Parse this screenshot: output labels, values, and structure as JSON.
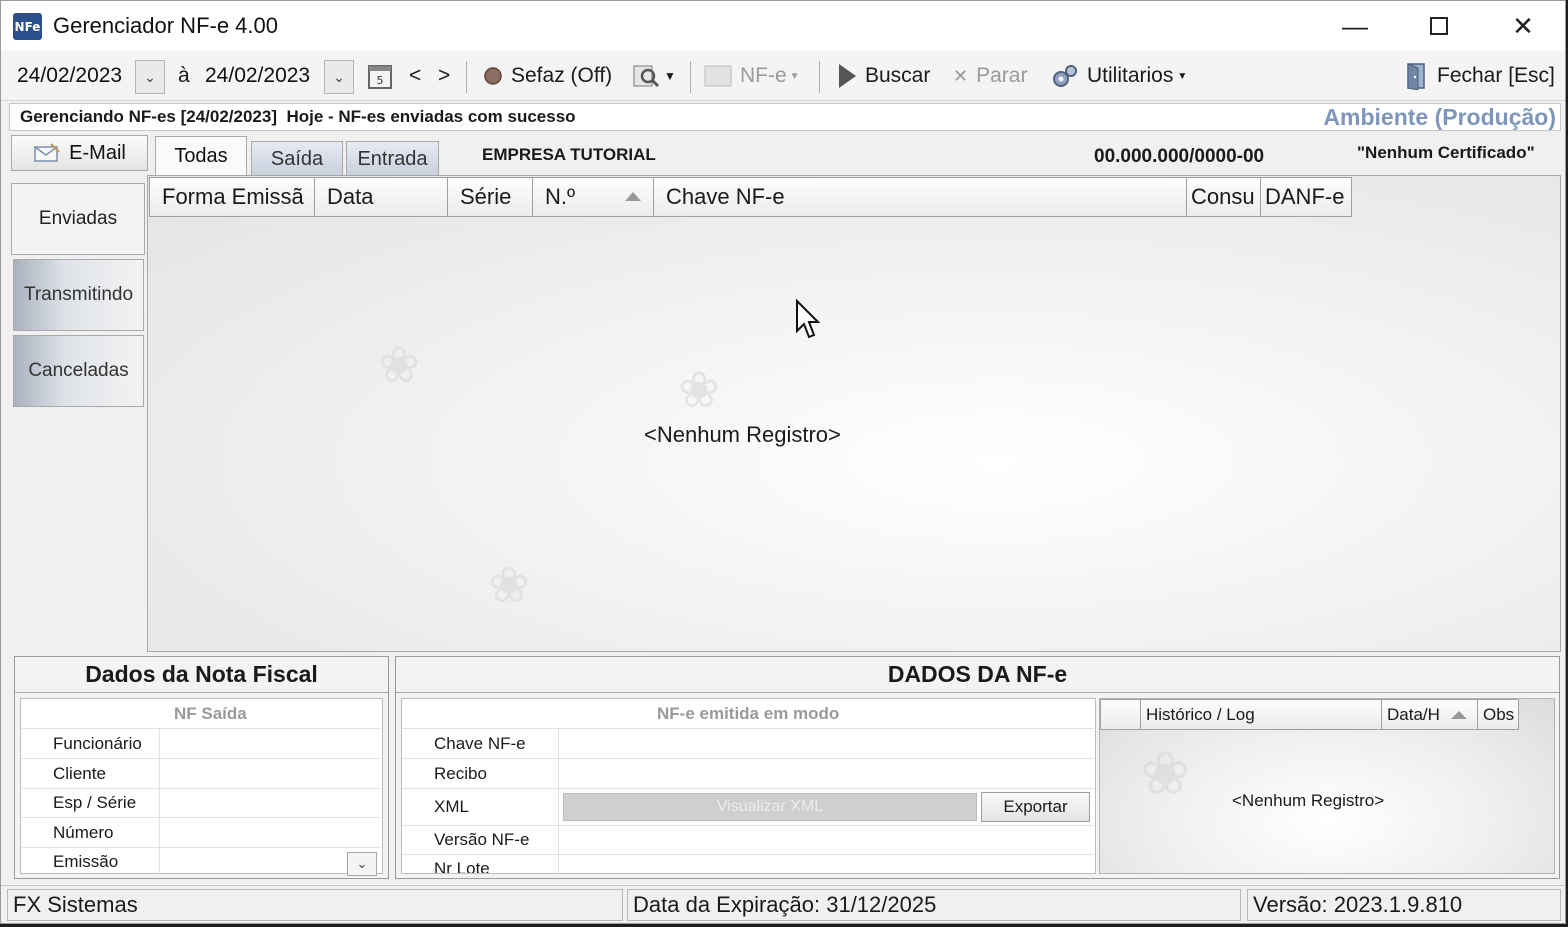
{
  "window": {
    "app_icon_text": "NFe",
    "title": "Gerenciador NF-e 4.00",
    "minimize": "—",
    "close": "✕"
  },
  "toolbar": {
    "date_from": "24/02/2023",
    "date_sep": "à",
    "date_to": "24/02/2023",
    "prev": "<",
    "next": ">",
    "sefaz": "Sefaz (Off)",
    "nfe": "NF-e",
    "buscar": "Buscar",
    "parar": "Parar",
    "utilitarios": "Utilitarios",
    "fechar": "Fechar [Esc]"
  },
  "header": {
    "status": "Gerenciando NF-es [24/02/2023]  Hoje - NF-es enviadas com sucesso",
    "ambiente": "Ambiente (Produção)"
  },
  "tabs": {
    "email": "E-Mail",
    "todas": "Todas",
    "saida": "Saída",
    "entrada": "Entrada"
  },
  "company": {
    "name": "EMPRESA TUTORIAL",
    "cnpj": "00.000.000/0000-00",
    "certificado": "\"Nenhum Certificado\""
  },
  "sidebar": {
    "items": [
      {
        "label": "Enviadas"
      },
      {
        "label": "Transmitindo"
      },
      {
        "label": "Canceladas"
      }
    ]
  },
  "grid": {
    "columns": [
      "Forma Emissã",
      "Data",
      "Série",
      "N.º",
      "Chave NF-e",
      "Consu",
      "DANF-e"
    ],
    "empty": "<Nenhum Registro>"
  },
  "nota_fiscal": {
    "title": "Dados da Nota Fiscal",
    "subtitle": "NF Saída",
    "fields": [
      "Funcionário",
      "Cliente",
      "Esp / Série",
      "Número",
      "Emissão"
    ]
  },
  "nfe_panel": {
    "title": "DADOS DA NF-e",
    "subtitle": "NF-e emitida em modo",
    "fields": [
      "Chave NF-e",
      "Recibo",
      "XML",
      "Versão NF-e",
      "Nr Lote"
    ],
    "visualizar_xml": "Visualizar XML",
    "exportar": "Exportar"
  },
  "historico": {
    "columns": [
      "Histórico / Log",
      "Data/H",
      "Obs"
    ],
    "empty": "<Nenhum Registro>"
  },
  "statusbar": {
    "company": "FX Sistemas",
    "expiracao": "Data da Expiração: 31/12/2025",
    "versao": "Versão: 2023.1.9.810"
  }
}
